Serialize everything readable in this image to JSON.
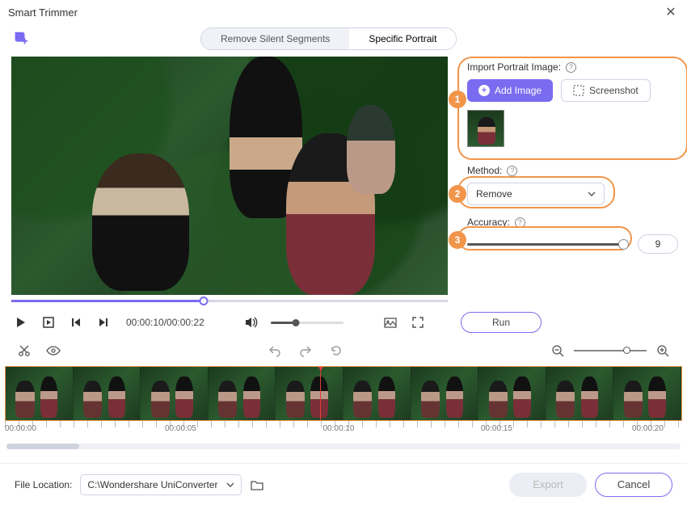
{
  "window": {
    "title": "Smart Trimmer"
  },
  "tabs": {
    "remove_silent": "Remove Silent Segments",
    "specific_portrait": "Specific Portrait"
  },
  "video": {
    "current_time": "00:00:10",
    "total_time": "00:00:22",
    "timecode": "00:00:10/00:00:22"
  },
  "panel": {
    "import_label": "Import Portrait Image:",
    "add_image": "Add Image",
    "screenshot": "Screenshot",
    "method_label": "Method:",
    "method_value": "Remove",
    "accuracy_label": "Accuracy:",
    "accuracy_value": "9",
    "run": "Run",
    "badges": {
      "one": "1",
      "two": "2",
      "three": "3"
    }
  },
  "timeline": {
    "ticks": [
      "00:00:00",
      "00:00:05",
      "00:00:10",
      "00:00:15",
      "00:00:20"
    ]
  },
  "footer": {
    "location_label": "File Location:",
    "location_value": "C:\\Wondershare UniConverter",
    "export": "Export",
    "cancel": "Cancel"
  }
}
